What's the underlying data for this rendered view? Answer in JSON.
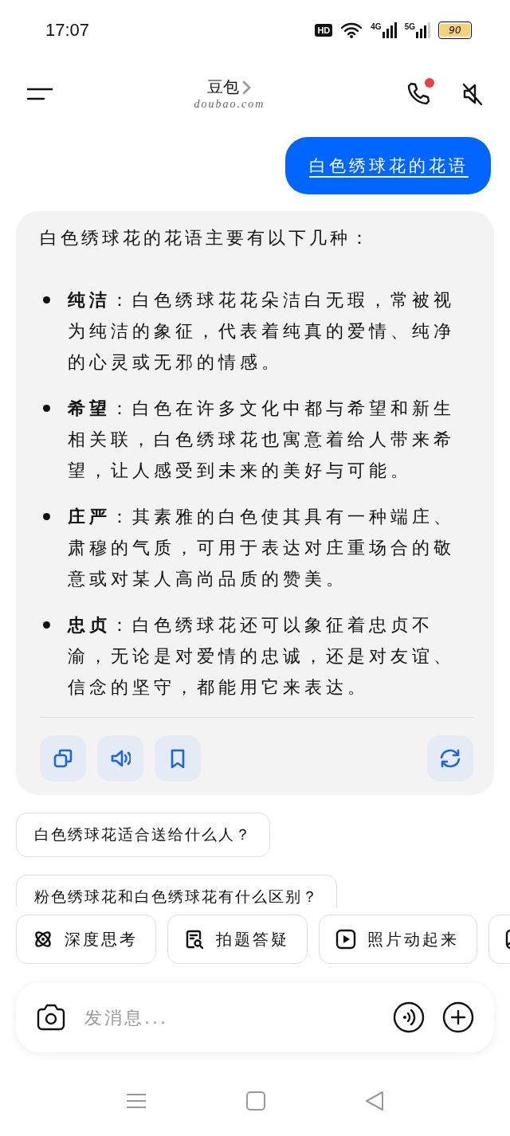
{
  "status_bar": {
    "time": "17:07",
    "hd_label": "HD",
    "network_labels": [
      "4G",
      "5G"
    ],
    "battery": "90"
  },
  "header": {
    "title": "豆包",
    "subtitle": "doubao.com",
    "call_badge": true
  },
  "user_message": {
    "text": "白色绣球花的花语"
  },
  "answer": {
    "intro": "白色绣球花的花语主要有以下几种：",
    "points": [
      "**纯洁**：白色绣球花花朵洁白无瑕，常被视为纯洁的象征，代表着纯真的爱情、纯净的心灵或无邪的情感。",
      "**希望**：白色在许多文化中都与希望和新生相关联，白色绣球花也寓意着给人带来希望，让人感受到未来的美好与可能。",
      "**庄严**：其素雅的白色使其具有一种端庄、肃穆的气质，可用于表达对庄重场合的敬意或对某人高尚品质的赞美。",
      "**忠贞**：白色绣球花还可以象征着忠贞不渝，无论是对爱情的忠诚，还是对友谊、信念的坚守，都能用它来表达。"
    ],
    "actions": [
      {
        "kind": "copy"
      },
      {
        "kind": "speak"
      },
      {
        "kind": "bookmark"
      }
    ],
    "regenerate": true
  },
  "suggestions": [
    {
      "text": "白色绣球花适合送给什么人？"
    },
    {
      "text": "粉色绣球花和白色绣球花有什么区别？"
    }
  ],
  "tools": [
    {
      "kind": "atom",
      "label": "深度思考"
    },
    {
      "kind": "doc-search",
      "label": "拍题答疑"
    },
    {
      "kind": "play",
      "label": "照片动起来"
    },
    {
      "kind": "image"
    }
  ],
  "input": {
    "placeholder": "发消息..."
  }
}
